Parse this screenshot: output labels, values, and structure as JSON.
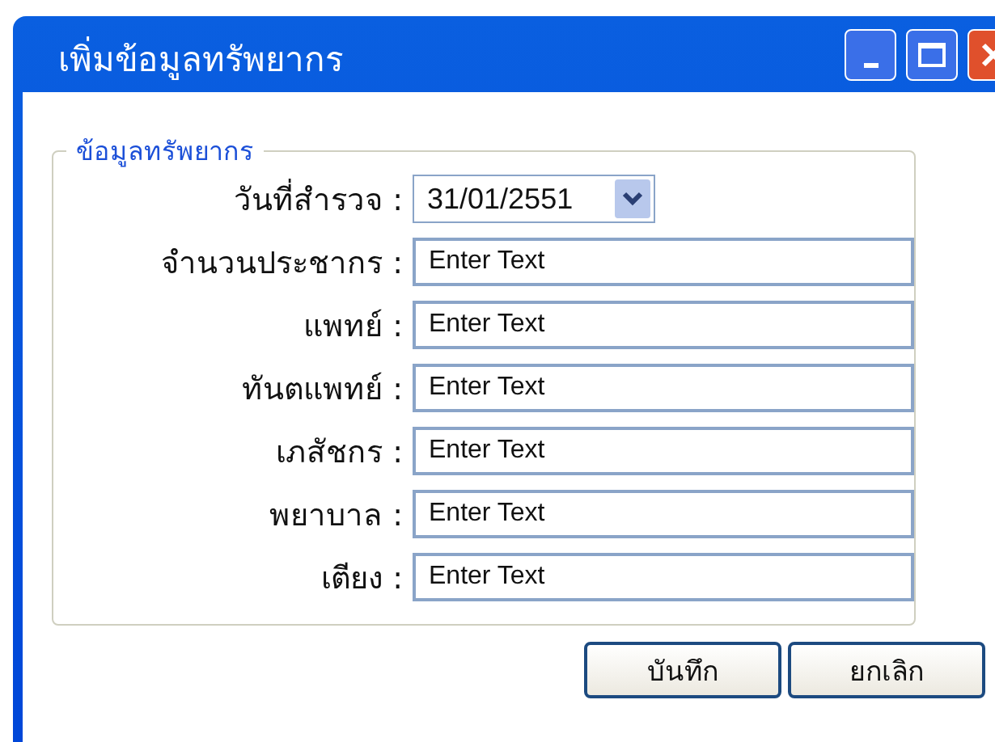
{
  "window": {
    "title": "เพิ่มข้อมูลทรัพยากร"
  },
  "group": {
    "legend": "ข้อมูลทรัพยากร"
  },
  "fields": [
    {
      "kind": "dropdown",
      "label": "วันที่สำรวจ :",
      "value": "31/01/2551"
    },
    {
      "kind": "text",
      "label": "จำนวนประชากร :",
      "value": "Enter Text"
    },
    {
      "kind": "text",
      "label": "แพทย์ :",
      "value": "Enter Text"
    },
    {
      "kind": "text",
      "label": "ทันตแพทย์ :",
      "value": "Enter Text"
    },
    {
      "kind": "text",
      "label": "เภสัชกร :",
      "value": "Enter Text"
    },
    {
      "kind": "text",
      "label": "พยาบาล :",
      "value": "Enter Text"
    },
    {
      "kind": "text",
      "label": "เตียง :",
      "value": "Enter Text"
    }
  ],
  "buttons": [
    "บันทึก",
    "ยกเลิก"
  ]
}
